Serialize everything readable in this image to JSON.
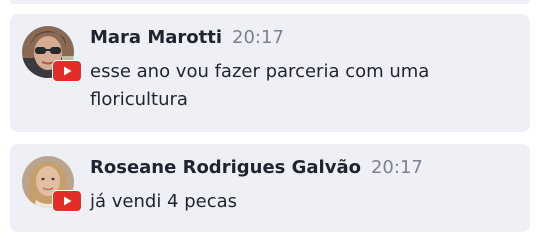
{
  "messages": [
    {
      "author": "Mara Marotti",
      "time": "20:17",
      "text": "esse ano vou fazer parceria com uma floricultura",
      "avatar_icon": "user-photo-sunglasses",
      "badge_icon": "youtube-icon"
    },
    {
      "author": "Roseane Rodrigues Galvão",
      "time": "20:17",
      "text": "já vendi 4 pecas",
      "avatar_icon": "user-photo-blonde",
      "badge_icon": "youtube-icon"
    }
  ],
  "colors": {
    "bubble_bg": "#eef0f5",
    "author": "#1f2430",
    "timestamp": "#7c8190",
    "youtube_red": "#e52d27"
  }
}
